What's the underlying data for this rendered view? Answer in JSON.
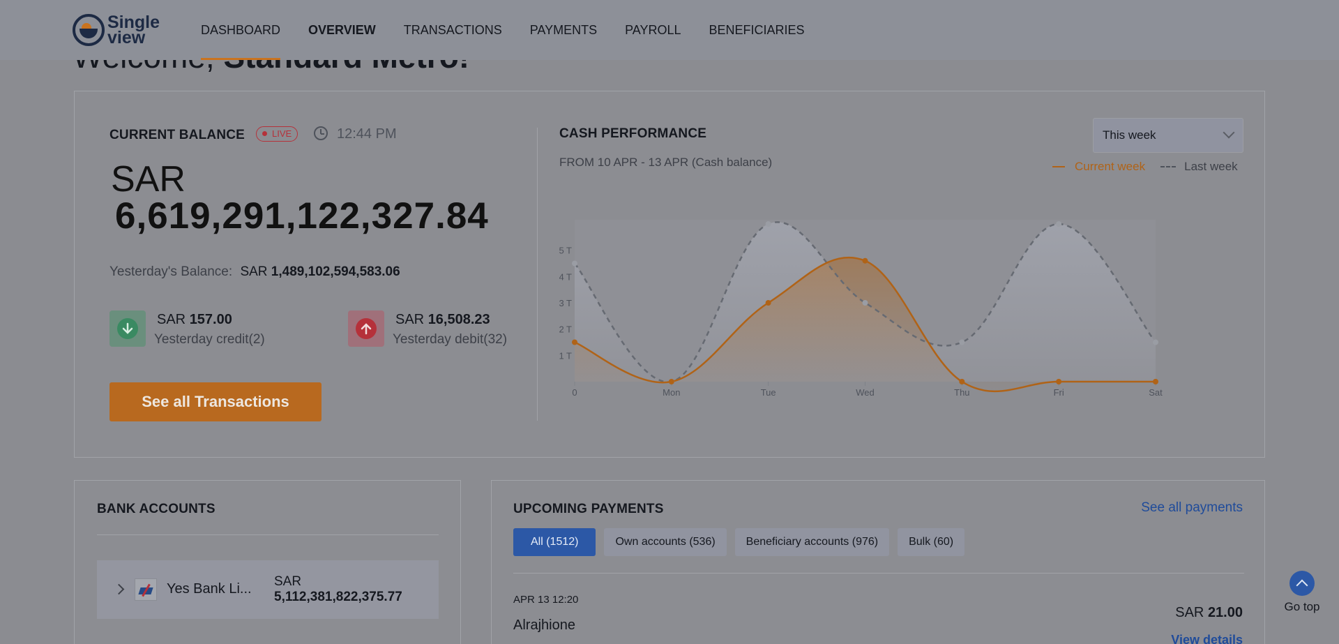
{
  "brand": {
    "name_line1": "Single",
    "name_line2": "view"
  },
  "nav": [
    {
      "label": "DASHBOARD"
    },
    {
      "label": "OVERVIEW"
    },
    {
      "label": "TRANSACTIONS"
    },
    {
      "label": "PAYMENTS"
    },
    {
      "label": "PAYROLL"
    },
    {
      "label": "BENEFICIARIES"
    }
  ],
  "welcome": {
    "greeting": "Welcome, ",
    "name": "Standard Metro!"
  },
  "balance": {
    "title": "CURRENT BALANCE",
    "live": "LIVE",
    "time": "12:44 PM",
    "currency": "SAR",
    "amount": "6,619,291,122,327.84",
    "yesterday_label": "Yesterday's Balance:",
    "yesterday_currency": "SAR",
    "yesterday_amount": "1,489,102,594,583.06",
    "credit": {
      "currency": "SAR",
      "amount": "157.00",
      "label": "Yesterday credit(2)"
    },
    "debit": {
      "currency": "SAR",
      "amount": "16,508.23",
      "label": "Yesterday debit(32)"
    },
    "cta": "See all Transactions"
  },
  "cash_performance": {
    "title": "CASH PERFORMANCE",
    "subtitle": "FROM 10 APR - 13 APR (Cash balance)",
    "period": "This week",
    "legend_current": "Current week",
    "legend_last": "Last week"
  },
  "chart_data": {
    "type": "area",
    "categories": [
      "0",
      "Mon",
      "Tue",
      "Wed",
      "Thu",
      "Fri",
      "Sat"
    ],
    "y_ticks": [
      "1 T",
      "2 T",
      "3 T",
      "4 T",
      "5 T"
    ],
    "ylim": [
      0,
      6
    ],
    "series": [
      {
        "name": "Current week",
        "values": [
          1.5,
          0,
          3,
          4.6,
          0,
          0,
          0
        ],
        "color": "#b06317"
      },
      {
        "name": "Last week",
        "values": [
          4.5,
          0,
          6,
          3,
          1.5,
          6,
          1.5
        ],
        "color": "#666a72"
      }
    ]
  },
  "bank_accounts": {
    "title": "BANK ACCOUNTS",
    "rows": [
      {
        "name": "Yes Bank Li...",
        "currency": "SAR",
        "amount": "5,112,381,822,375.77"
      }
    ]
  },
  "upcoming_payments": {
    "title": "UPCOMING PAYMENTS",
    "see_all": "See all payments",
    "filters": [
      "All (1512)",
      "Own accounts (536)",
      "Beneficiary accounts (976)",
      "Bulk (60)"
    ],
    "items": [
      {
        "date": "APR 13 12:20",
        "name": "Alrajhione",
        "currency": "SAR",
        "amount": "21.00",
        "details": "View details"
      }
    ]
  },
  "go_top": "Go top"
}
